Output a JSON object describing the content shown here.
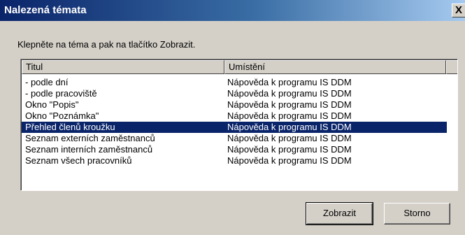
{
  "window": {
    "title": "Nalezená témata",
    "close_symbol": "X"
  },
  "instruction": "Klepněte na téma a pak na tlačítko Zobrazit.",
  "list": {
    "columns": [
      "Titul",
      "Umístění"
    ],
    "rows": [
      {
        "title": "- podle dní",
        "location": "Nápověda k programu IS DDM"
      },
      {
        "title": "- podle pracoviště",
        "location": "Nápověda k programu IS DDM"
      },
      {
        "title": "Okno \"Popis\"",
        "location": "Nápověda k programu IS DDM"
      },
      {
        "title": "Okno \"Poznámka\"",
        "location": "Nápověda k programu IS DDM"
      },
      {
        "title": "Přehled členů kroužku",
        "location": "Nápověda k programu IS DDM",
        "selected": true
      },
      {
        "title": "Seznam externích zaměstnanců",
        "location": "Nápověda k programu IS DDM"
      },
      {
        "title": "Seznam interních zaměstnanců",
        "location": "Nápověda k programu IS DDM"
      },
      {
        "title": "Seznam všech pracovníků",
        "location": "Nápověda k programu IS DDM"
      }
    ]
  },
  "buttons": {
    "show": "Zobrazit",
    "cancel": "Storno"
  },
  "colors": {
    "selection": "#0a246a",
    "titlebar_start": "#0a246a",
    "titlebar_end": "#a6caf0",
    "face": "#d4d0c8"
  }
}
